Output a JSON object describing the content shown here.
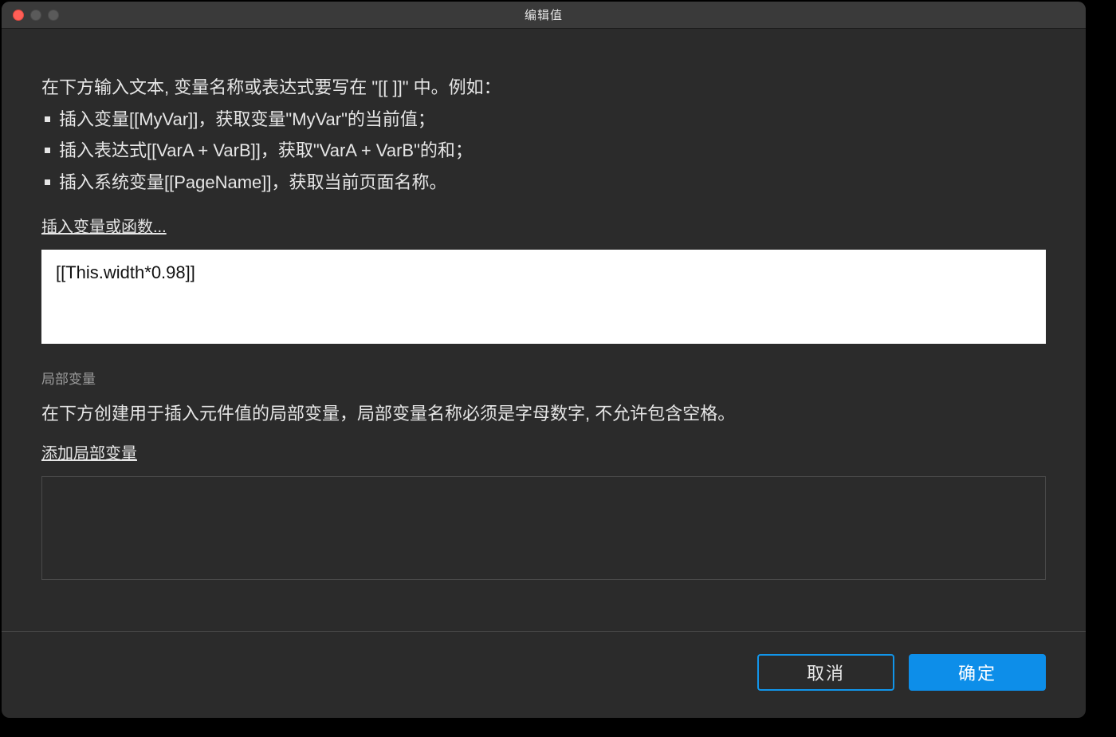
{
  "window": {
    "title": "编辑值"
  },
  "instructions": {
    "lead": "在下方输入文本, 变量名称或表达式要写在 \"[[ ]]\" 中。例如：",
    "bullets": [
      "插入变量[[MyVar]]，获取变量\"MyVar\"的当前值；",
      "插入表达式[[VarA + VarB]]，获取\"VarA + VarB\"的和；",
      "插入系统变量[[PageName]]，获取当前页面名称。"
    ]
  },
  "links": {
    "insert_var_or_fn": "插入变量或函数...",
    "add_local_var": "添加局部变量"
  },
  "expression": {
    "value": "[[This.width*0.98]]"
  },
  "local_vars": {
    "label": "局部变量",
    "description": "在下方创建用于插入元件值的局部变量，局部变量名称必须是字母数字, 不允许包含空格。"
  },
  "buttons": {
    "cancel": "取消",
    "ok": "确定"
  }
}
